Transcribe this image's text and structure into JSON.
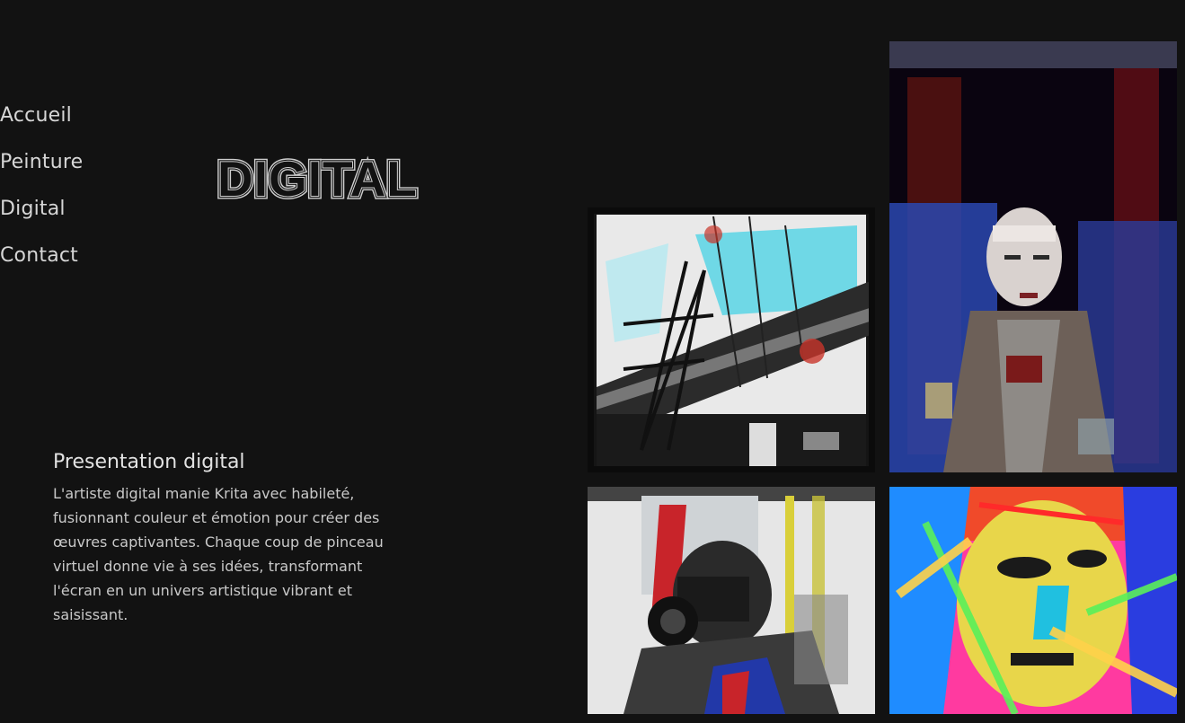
{
  "nav": {
    "items": [
      {
        "label": "Accueil"
      },
      {
        "label": "Peinture"
      },
      {
        "label": "Digital"
      },
      {
        "label": "Contact"
      }
    ]
  },
  "header": {
    "title": "DIGITAL"
  },
  "presentation": {
    "heading": "Presentation digital",
    "lines": [
      "L'artiste digital manie Krita avec habileté,",
      "fusionnant couleur et émotion pour créer des",
      "œuvres captivantes. Chaque coup de pinceau",
      "virtuel donne vie à ses idées, transformant",
      "l'écran en un univers artistique vibrant et",
      "saisissant."
    ]
  },
  "gallery": {
    "artworks": [
      {
        "name": "bridge-artwork"
      },
      {
        "name": "geisha-artwork"
      },
      {
        "name": "photographer-artwork"
      },
      {
        "name": "colorful-face-artwork"
      }
    ]
  },
  "colors": {
    "background": "#121212",
    "text": "#d6d6d6"
  }
}
